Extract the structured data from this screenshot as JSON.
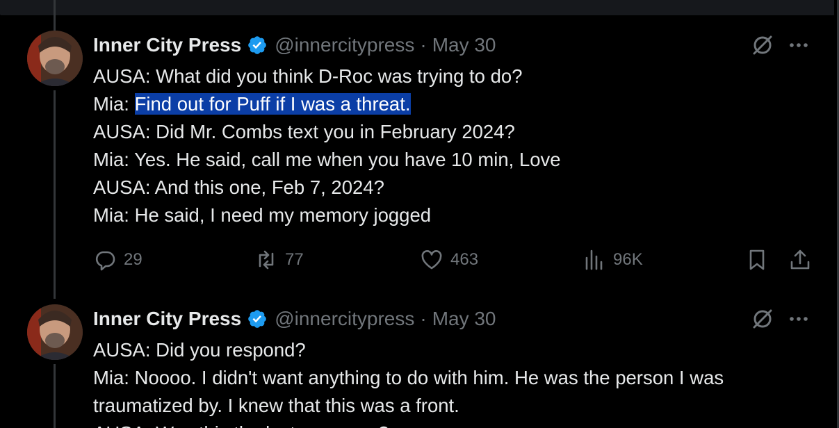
{
  "tweets": [
    {
      "author": "Inner City Press",
      "handle": "@innercitypress",
      "separator": "·",
      "date": "May 30",
      "lines": [
        {
          "text": "AUSA: What did you think D-Roc was trying to do?"
        },
        {
          "prefix": "Mia: ",
          "highlight": "Find out for Puff if I was a threat."
        },
        {
          "text": "AUSA: Did Mr. Combs text you in February 2024?"
        },
        {
          "text": "Mia: Yes. He said, call me when you have 10 min, Love"
        },
        {
          "text": "AUSA: And this one, Feb 7, 2024?"
        },
        {
          "text": "Mia: He said, I need my memory jogged"
        }
      ],
      "stats": {
        "replies": "29",
        "reposts": "77",
        "likes": "463",
        "views": "96K"
      }
    },
    {
      "author": "Inner City Press",
      "handle": "@innercitypress",
      "separator": "·",
      "date": "May 30",
      "lines": [
        {
          "text": "AUSA: Did you respond?"
        },
        {
          "text": "Mia: Noooo. I didn't want anything to do with him. He was the person I was"
        },
        {
          "text": "traumatized by. I knew that this was a front."
        },
        {
          "text": "AUSA: Was this the last message?"
        }
      ]
    }
  ],
  "colors": {
    "background": "#000000",
    "text": "#e7e9ea",
    "muted": "#71767b",
    "verified": "#1d9bf0",
    "highlight": "#0b3ea6"
  },
  "icons": [
    "verified-badge-icon",
    "grok-icon",
    "more-icon",
    "reply-icon",
    "repost-icon",
    "like-icon",
    "views-icon",
    "bookmark-icon",
    "share-icon"
  ]
}
